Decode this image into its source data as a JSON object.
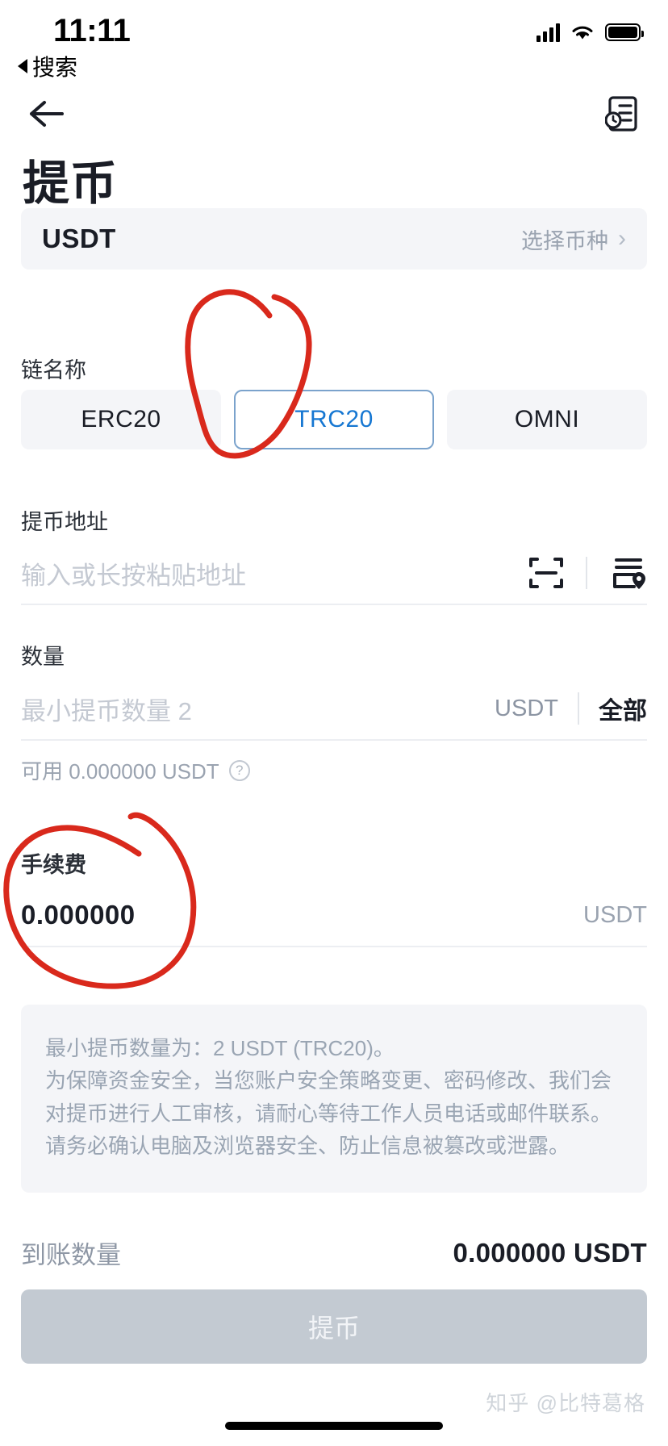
{
  "status_bar": {
    "time": "11:11",
    "back_label": "搜索",
    "signal_icon": "cellular-bars-icon",
    "wifi_icon": "wifi-icon",
    "battery_icon": "battery-full-icon"
  },
  "nav": {
    "back_icon": "arrow-left-icon",
    "history_icon": "withdraw-record-icon"
  },
  "header": {
    "title": "提币"
  },
  "coin_selector": {
    "coin": "USDT",
    "action_label": "选择币种",
    "chevron": "›"
  },
  "chain": {
    "label": "链名称",
    "options": [
      {
        "name": "ERC20",
        "selected": false
      },
      {
        "name": "TRC20",
        "selected": true
      },
      {
        "name": "OMNI",
        "selected": false
      }
    ]
  },
  "address": {
    "label": "提币地址",
    "value": "",
    "placeholder": "输入或长按粘贴地址",
    "scan_icon": "qr-scan-icon",
    "addressbook_icon": "address-book-icon"
  },
  "amount": {
    "label": "数量",
    "value": "",
    "placeholder": "最小提币数量 2",
    "unit": "USDT",
    "all_label": "全部",
    "available_text": "可用 0.000000 USDT",
    "help_icon": "question-mark-icon"
  },
  "fee": {
    "label": "手续费",
    "value": "0.000000",
    "unit": "USDT"
  },
  "notice": {
    "lines": [
      "最小提币数量为：2 USDT (TRC20)。",
      "为保障资金安全，当您账户安全策略变更、密码修改、我们会对提币进行人工审核，请耐心等待工作人员电话或邮件联系。",
      "请务必确认电脑及浏览器安全、防止信息被篡改或泄露。"
    ]
  },
  "receive": {
    "label": "到账数量",
    "value": "0.000000 USDT"
  },
  "submit": {
    "label": "提币",
    "enabled": false
  },
  "watermark": {
    "text": "知乎 @比特葛格"
  },
  "annotations": {
    "color": "#d9291c",
    "marks": [
      {
        "name": "circle-around-trc20-tab",
        "target": "TRC20"
      },
      {
        "name": "circle-around-fee",
        "target": "手续费 0.000000"
      }
    ]
  }
}
